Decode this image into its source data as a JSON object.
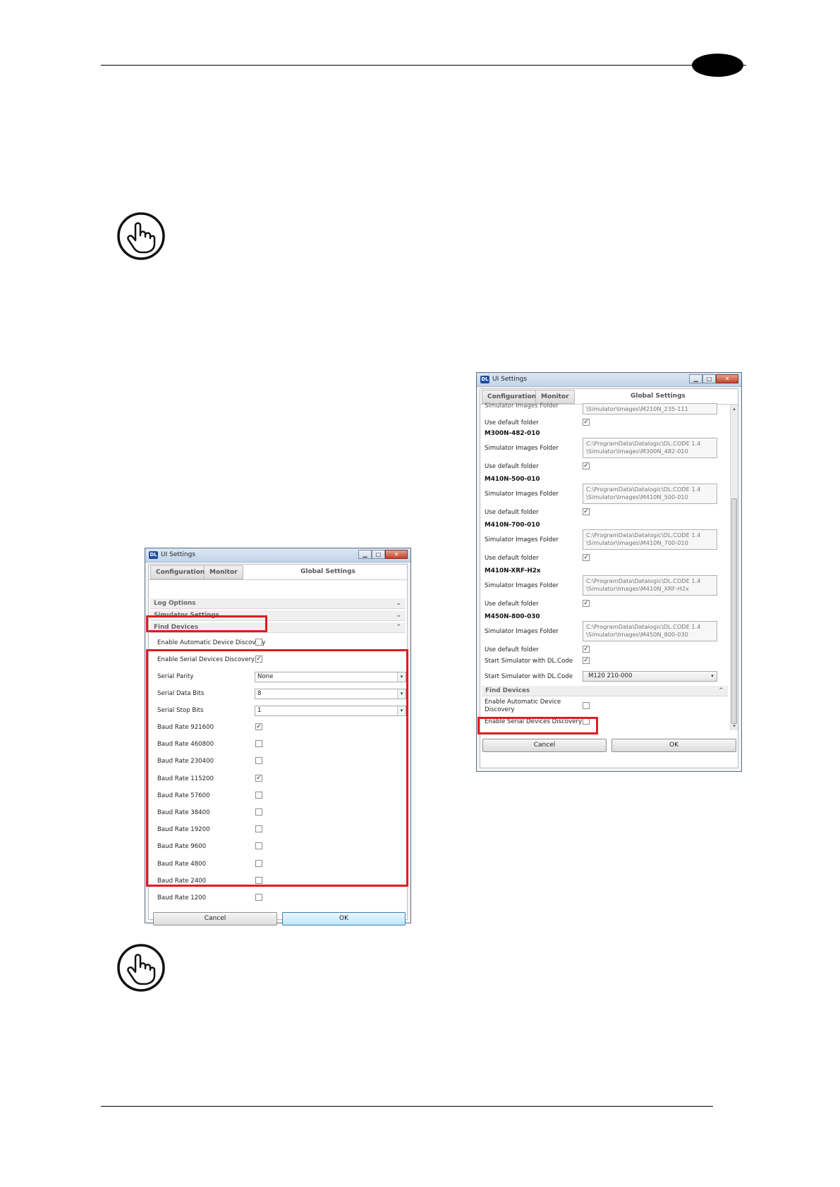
{
  "page": {},
  "window_left": {
    "title": "UI Settings",
    "logo": "DL",
    "tabs": [
      "Configuration",
      "Monitor"
    ],
    "active_tab_title": "Global Settings",
    "sections": {
      "log_options": "Log Options",
      "simulator_settings": "Simulator Settings",
      "find_devices": "Find Devices"
    },
    "enable_auto_discovery": "Enable Automatic Device Discovery",
    "enable_serial_discovery": "Enable Serial Devices Discovery",
    "serial_parity": {
      "label": "Serial Parity",
      "value": "None"
    },
    "serial_data_bits": {
      "label": "Serial Data Bits",
      "value": "8"
    },
    "serial_stop_bits": {
      "label": "Serial Stop Bits",
      "value": "1"
    },
    "baud_rates": [
      {
        "label": "Baud Rate 921600",
        "checked": true
      },
      {
        "label": "Baud Rate 460800",
        "checked": false
      },
      {
        "label": "Baud Rate 230400",
        "checked": false
      },
      {
        "label": "Baud Rate 115200",
        "checked": true
      },
      {
        "label": "Baud Rate 57600",
        "checked": false
      },
      {
        "label": "Baud Rate 38400",
        "checked": false
      },
      {
        "label": "Baud Rate 19200",
        "checked": false
      },
      {
        "label": "Baud Rate 9600",
        "checked": false
      },
      {
        "label": "Baud Rate 4800",
        "checked": false
      },
      {
        "label": "Baud Rate 2400",
        "checked": false
      },
      {
        "label": "Baud Rate 1200",
        "checked": false
      }
    ],
    "cancel": "Cancel",
    "ok": "OK"
  },
  "window_right": {
    "title": "UI Settings",
    "logo": "DL",
    "tabs": [
      "Configuration",
      "Monitor"
    ],
    "active_tab_title": "Global Settings",
    "top_partial_label": "Simulator Images Folder",
    "top_partial_path": "\\Simulator\\Images\\M210N_235-111",
    "use_default_folder": "Use default folder",
    "simulator_images_folder": "Simulator Images Folder",
    "models": [
      {
        "name": "M300N-482-010",
        "path1": "C:\\ProgramData\\Datalogic\\DL.CODE 1.4",
        "path2": "\\Simulator\\Images\\M300N_482-010"
      },
      {
        "name": "M410N-500-010",
        "path1": "C:\\ProgramData\\Datalogic\\DL.CODE 1.4",
        "path2": "\\Simulator\\Images\\M410N_500-010"
      },
      {
        "name": "M410N-700-010",
        "path1": "C:\\ProgramData\\Datalogic\\DL.CODE 1.4",
        "path2": "\\Simulator\\Images\\M410N_700-010"
      },
      {
        "name": "M410N-XRF-H2x",
        "path1": "C:\\ProgramData\\Datalogic\\DL.CODE 1.4",
        "path2": "\\Simulator\\Images\\M410N_XRF-H2x"
      },
      {
        "name": "M450N-800-030",
        "path1": "C:\\ProgramData\\Datalogic\\DL.CODE 1.4",
        "path2": "\\Simulator\\Images\\M450N_800-030"
      }
    ],
    "start_sim_check": "Start Simulator with DL.Code",
    "start_sim_select": "Start Simulator with DL.Code",
    "start_sim_value": "M120 210-000",
    "find_devices": "Find Devices",
    "enable_auto_discovery_line1": "Enable Automatic Device",
    "enable_auto_discovery_line2": "Discovery",
    "enable_serial_discovery": "Enable Serial Devices Discovery",
    "cancel": "Cancel",
    "ok": "OK"
  }
}
